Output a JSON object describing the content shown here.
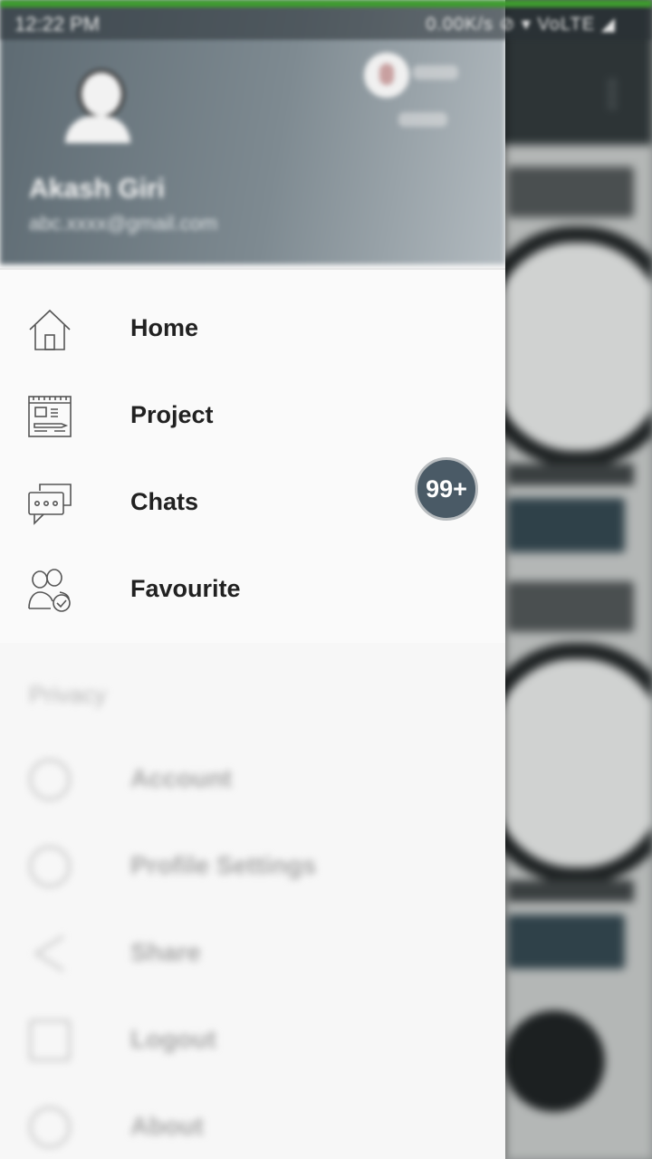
{
  "status_bar": {
    "time": "12:22 PM",
    "right_text": "0.00K/s ⊘ ▾ VoLTE ◢"
  },
  "header": {
    "user_name": "Akash Giri",
    "user_email": "abc.xxxx@gmail.com"
  },
  "menu": {
    "items": [
      {
        "label": "Home",
        "icon": "home-icon"
      },
      {
        "label": "Project",
        "icon": "project-icon"
      },
      {
        "label": "Chats",
        "icon": "chat-icon"
      },
      {
        "label": "Favourite",
        "icon": "favourite-users-icon"
      }
    ],
    "chats_badge": "99+"
  },
  "privacy": {
    "section_title": "Privacy",
    "items": [
      {
        "label": "Account",
        "icon": "account-icon"
      },
      {
        "label": "Profile Settings",
        "icon": "profile-settings-icon"
      },
      {
        "label": "Share",
        "icon": "share-icon"
      },
      {
        "label": "Logout",
        "icon": "logout-icon"
      },
      {
        "label": "About",
        "icon": "about-icon"
      }
    ]
  },
  "colors": {
    "badge_bg": "#4a5a66",
    "status_accent": "#3e9d2e",
    "toolbar": "#2d3436"
  }
}
